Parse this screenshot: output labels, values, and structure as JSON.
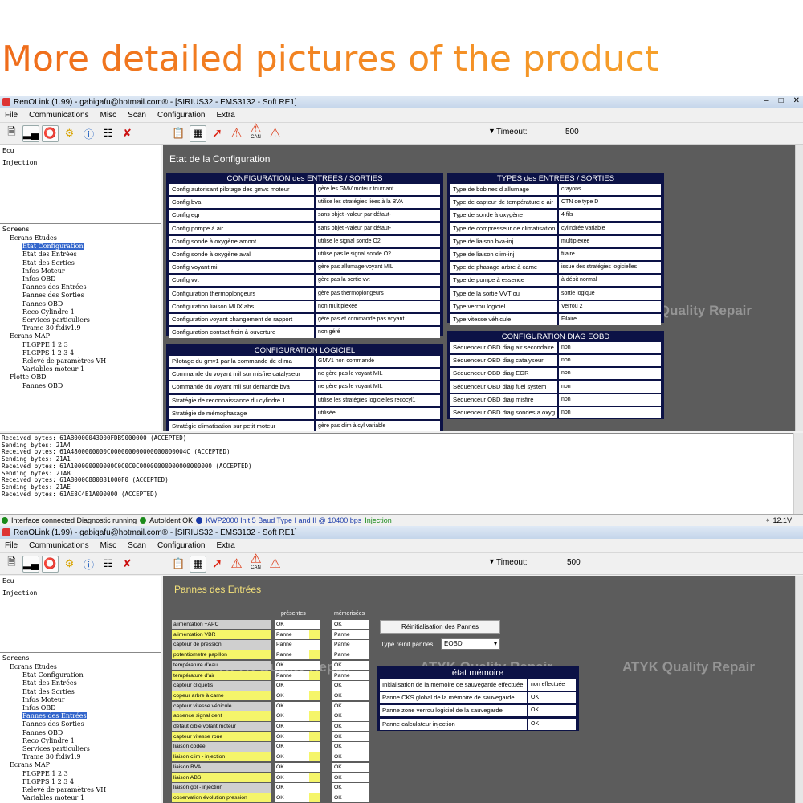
{
  "headline": "More detailed pictures of the product",
  "window1": {
    "title": "RenOLink (1.99) - gabigafu@hotmail.com® - [SIRIUS32 - EMS3132 - Soft RE1]",
    "menu": [
      "File",
      "Communications",
      "Misc",
      "Scan",
      "Configuration",
      "Extra"
    ],
    "toolbar": {
      "timeout_label": "Timeout:",
      "timeout_value": "500",
      "can_label": "CAN"
    },
    "ecu_label": "Ecu",
    "ecu_item": "Injection",
    "screens_label": "Screens",
    "tree": [
      "Ecrans Etudes",
      "Etat Configuration",
      "Etat des Entrées",
      "Etat des Sorties",
      "Infos Moteur",
      "Infos OBD",
      "Pannes des Entrées",
      "Pannes des Sorties",
      "Pannes OBD",
      "Reco Cylindre 1",
      "Services particuliers",
      "Trame 30 ftdiv1.9",
      "Ecrans MAP",
      "FLGPPE 1 2 3",
      "FLGPPS 1 2 3 4",
      "Relevé de paramètres VH",
      "Variables moteur 1",
      "Flotte OBD",
      "Pannes OBD"
    ],
    "content_title": "Etat de la Configuration",
    "panel_io": {
      "title": "CONFIGURATION des ENTREES / SORTIES",
      "rows": [
        [
          "Config autorisant pilotage des gmvs moteur",
          "gère les GMV moteur tournant"
        ],
        [
          "Config bva",
          "utilise les stratégies liées à la BVA"
        ],
        [
          "Config egr",
          "sans objet -valeur par défaut-"
        ],
        [
          "Config pompe à air",
          "sans objet -valeur par défaut-"
        ],
        [
          "Config sonde à oxygène amont",
          "utilise le signal sonde O2"
        ],
        [
          "Config sonde à oxygène aval",
          "utilise pas le signal sonde O2"
        ],
        [
          "Config voyant mil",
          "gère pas allumage voyant MIL"
        ],
        [
          "Config vvt",
          "gère pas la sortie vvt"
        ],
        [
          "Configuration thermoplongeurs",
          "gère pas thermoplongeurs"
        ],
        [
          "Configuration liaison MUX abs",
          "non multiplexée"
        ],
        [
          "Configuration voyant changement de rapport",
          "gère pas et commande pas voyant"
        ],
        [
          "Configuration contact frein à ouverture",
          "non géré"
        ]
      ]
    },
    "panel_types": {
      "title": "TYPES des ENTREES / SORTIES",
      "rows": [
        [
          "Type de bobines d allumage",
          "crayons"
        ],
        [
          "Type de capteur de température d air",
          "CTN de type D"
        ],
        [
          "Type de sonde à oxygène",
          "4 fils"
        ],
        [
          "Type de compresseur de climatisation",
          "cylindrée variable"
        ],
        [
          "Type de liaison bva-inj",
          "multiplexée"
        ],
        [
          "Type de liaison clim-inj",
          "filaire"
        ],
        [
          "Type de phasage arbre à came",
          "issue des stratégies logicielles"
        ],
        [
          "Type de pompe à essence",
          "à débit normal"
        ],
        [
          "Type de la sortie VVT ou",
          "sortie logique"
        ],
        [
          "Type verrou logiciel",
          "Verrou 2"
        ],
        [
          "Type vitesse véhicule",
          "Filaire"
        ]
      ]
    },
    "panel_soft": {
      "title": "CONFIGURATION LOGICIEL",
      "rows": [
        [
          "Pilotage du gmv1 par la commande de clima",
          "GMV1 non commandé"
        ],
        [
          "Commande du voyant mil sur misfire catalyseur",
          "ne gère pas le voyant MIL"
        ],
        [
          "Commande du voyant mil sur demande bva",
          "ne gère pas le voyant MIL"
        ],
        [
          "Stratégie de reconnaissance du cylindre 1",
          "utilise les stratégies logicielles recocyl1"
        ],
        [
          "Stratégie de mémophasage",
          "utilisée"
        ],
        [
          "Stratégie climatisation sur petit moteur",
          "gère pas clim à cyl variable"
        ]
      ]
    },
    "panel_diag": {
      "title": "CONFIGURATION DIAG EOBD",
      "rows": [
        [
          "Séquenceur OBD diag air secondaire",
          "non"
        ],
        [
          "Séquenceur OBD diag catalyseur",
          "non"
        ],
        [
          "Séquenceur OBD diag EGR",
          "non"
        ],
        [
          "Séquenceur OBD diag fuel system",
          "non"
        ],
        [
          "Séquenceur OBD diag misfire",
          "non"
        ],
        [
          "Séquenceur OBD diag sondes a oxyg",
          "non"
        ]
      ]
    },
    "log": [
      "Received bytes: 61AB0000043000FDB9000000  (ACCEPTED)",
      "Sending bytes: 21A4",
      "Received bytes: 61A4800000000C000000000000000000004C  (ACCEPTED)",
      "Sending bytes: 21A1",
      "Received bytes: 61A100000000000C0C0C0C00000000000000000000  (ACCEPTED)",
      "Sending bytes: 21A8",
      "Received bytes: 61A8000C880881000F0  (ACCEPTED)",
      "Sending bytes: 21AE",
      "Received bytes: 61AE8C4E1A000000  (ACCEPTED)"
    ],
    "watermark": "ATYK Quality Repair"
  },
  "statusbar": {
    "connected": "Interface connected Diagnostic running",
    "autoident": "AutoIdent OK",
    "protocol": "KWP2000 Init 5 Baud Type I and II @ 10400 bps",
    "ecu": "Injection",
    "voltage": "12.1V"
  },
  "window2": {
    "title": "RenOLink (1.99) - gabigafu@hotmail.com® - [SIRIUS32 - EMS3132 - Soft RE1]",
    "menu": [
      "File",
      "Communications",
      "Misc",
      "Scan",
      "Configuration",
      "Extra"
    ],
    "toolbar": {
      "timeout_label": "Timeout:",
      "timeout_value": "500",
      "can_label": "CAN"
    },
    "ecu_label": "Ecu",
    "ecu_item": "Injection",
    "screens_label": "Screens",
    "tree": [
      "Ecrans Etudes",
      "Etat Configuration",
      "Etat des Entrées",
      "Etat des Sorties",
      "Infos Moteur",
      "Infos OBD",
      "Pannes des Entrées",
      "Pannes des Sorties",
      "Pannes OBD",
      "Reco Cylindre 1",
      "Services particuliers",
      "Trame 30 ftdiv1.9",
      "Ecrans MAP",
      "FLGPPE 1 2 3",
      "FLGPPS 1 2 3 4",
      "Relevé de paramètres VH",
      "Variables moteur 1"
    ],
    "content_title": "Pannes des Entrées",
    "col_present": "présentes",
    "col_memo": "mémorisées",
    "faults": [
      [
        "alimentation +APC",
        "OK",
        "OK"
      ],
      [
        "alimentation VBR",
        "Panne",
        "Panne"
      ],
      [
        "capteur de pression",
        "Panne",
        "Panne"
      ],
      [
        "potentiometre papillon",
        "Panne",
        "Panne"
      ],
      [
        "température d'eau",
        "OK",
        "OK"
      ],
      [
        "température d'air",
        "Panne",
        "Panne"
      ],
      [
        "capteur cliquetis",
        "OK",
        "OK"
      ],
      [
        "copeur arbre à came",
        "OK",
        "OK"
      ],
      [
        "capteur vitesse véhicule",
        "OK",
        "OK"
      ],
      [
        "absence signal dent",
        "OK",
        "OK"
      ],
      [
        "défaut cible volant moteur",
        "OK",
        "OK"
      ],
      [
        "capteur vitesse roue",
        "OK",
        "OK"
      ],
      [
        "liaison codée",
        "OK",
        "OK"
      ],
      [
        "liaison clim - injection",
        "OK",
        "OK"
      ],
      [
        "liaison BVA",
        "OK",
        "OK"
      ],
      [
        "liaison ABS",
        "OK",
        "OK"
      ],
      [
        "liaison gpl - injection",
        "OK",
        "OK"
      ],
      [
        "observation évolution pression",
        "OK",
        "OK"
      ]
    ],
    "reset_button": "Réinitialisation des Pannes",
    "reset_type_label": "Type reinit pannes",
    "reset_type_value": "EOBD",
    "memory_panel": {
      "title": "état mémoire",
      "rows": [
        [
          "Initialisation de la mémoire de sauvegarde effectuée",
          "non effectuée"
        ],
        [
          "Panne CKS global de la mémoire de sauvegarde",
          "OK"
        ],
        [
          "Panne zone verrou logiciel de la sauvegarde",
          "OK"
        ],
        [
          "Panne calculateur injection",
          "OK"
        ]
      ]
    },
    "watermark": "ATYK Quality Repair"
  }
}
